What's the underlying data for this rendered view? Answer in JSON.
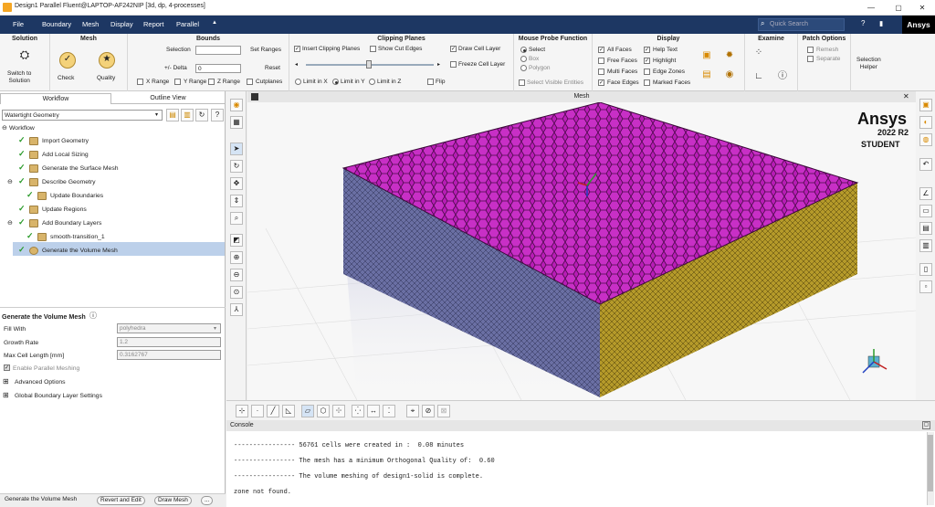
{
  "window": {
    "title": "Design1 Parallel Fluent@LAPTOP-AF242NIP  [3d, dp, 4-processes]",
    "minimize": "—",
    "maximize": "▢",
    "close": "✕",
    "brand": "Ansys"
  },
  "menu": {
    "items": [
      "File",
      "Boundary",
      "Mesh",
      "Display",
      "Report",
      "Parallel"
    ],
    "expand": "▲",
    "search_placeholder": "Quick Search",
    "help": "?",
    "info": "▮"
  },
  "ribbon": {
    "solution": {
      "title": "Solution",
      "switch_label": "Switch to\nSolution"
    },
    "mesh": {
      "title": "Mesh",
      "check": "Check",
      "quality": "Quality"
    },
    "bounds": {
      "title": "Bounds",
      "selection": "Selection",
      "set_ranges": "Set Ranges",
      "delta_label": "+/- Delta",
      "delta_value": "0",
      "reset": "Reset",
      "x_range": "X Range",
      "y_range": "Y Range",
      "z_range": "Z Range",
      "cutplanes": "Cutplanes"
    },
    "clipping": {
      "title": "Clipping Planes",
      "insert": "Insert Clipping Planes",
      "show_cut": "Show Cut Edges",
      "draw_cell": "Draw Cell Layer",
      "freeze_cell": "Freeze Cell Layer",
      "limit_x": "Limit in X",
      "limit_y": "Limit in Y",
      "limit_z": "Limit in Z",
      "flip": "Flip",
      "slider_value": 0.5
    },
    "probe": {
      "title": "Mouse Probe Function",
      "select": "Select",
      "box": "Box",
      "polygon": "Polygon",
      "select_visible": "Select Visible Entities"
    },
    "display": {
      "title": "Display",
      "all_faces": "All Faces",
      "free_faces": "Free Faces",
      "multi_faces": "Multi Faces",
      "face_edges": "Face Edges",
      "help_text": "Help Text",
      "highlight": "Highlight",
      "edge_zones": "Edge Zones",
      "marked_faces": "Marked Faces"
    },
    "examine": {
      "title": "Examine"
    },
    "patch": {
      "title": "Patch Options",
      "remesh": "Remesh",
      "separate": "Separate"
    },
    "selection_helper": "Selection\nHelper"
  },
  "left": {
    "tabs": [
      "Workflow",
      "Outline View"
    ],
    "workflow_select": "Watertight Geometry",
    "tree_root": "Workflow",
    "tasks": [
      "Import Geometry",
      "Add Local Sizing",
      "Generate the Surface Mesh",
      "Describe Geometry",
      "Update Boundaries",
      "Update Regions",
      "Add Boundary Layers",
      "smooth-transition_1",
      "Generate the Volume Mesh"
    ],
    "panel_title": "Generate the Volume Mesh",
    "fill_with_label": "Fill With",
    "fill_with_value": "polyhedra",
    "growth_label": "Growth Rate",
    "growth_value": "1.2",
    "maxcell_label": "Max Cell Length [mm]",
    "maxcell_value": "0.3162767",
    "parallel": "Enable Parallel Meshing",
    "advanced": "Advanced Options",
    "global_bl": "Global Boundary Layer Settings",
    "status": {
      "task": "Generate the Volume Mesh",
      "revert": "Revert and Edit",
      "draw": "Draw Mesh",
      "more": "..."
    }
  },
  "viewport": {
    "title": "Mesh",
    "brand": "Ansys",
    "version": "2022 R2",
    "edition": "STUDENT",
    "colors": {
      "top": "#b81cb6",
      "front": "#6a6fa3",
      "right": "#b59a2a"
    }
  },
  "console": {
    "title": "Console",
    "lines": [
      "---------------- 56761 cells were created in :  0.08 minutes",
      "---------------- The mesh has a minimum Orthogonal Quality of:  0.60",
      "---------------- The volume meshing of design1-solid is complete.",
      "zone not found."
    ]
  }
}
